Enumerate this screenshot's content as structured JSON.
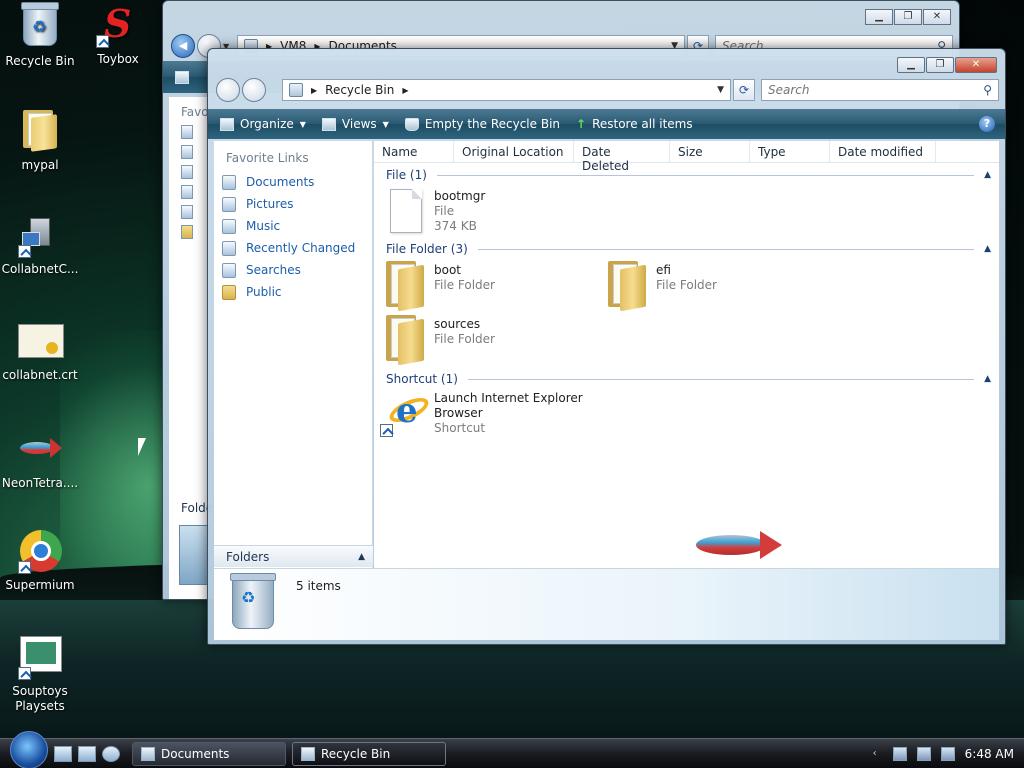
{
  "desktop": {
    "icons": [
      {
        "label": "Recycle Bin"
      },
      {
        "label": "Toybox"
      },
      {
        "label": "mypal"
      },
      {
        "label": "CollabnetC..."
      },
      {
        "label": "collabnet.crt"
      },
      {
        "label": "NeonTetra...."
      },
      {
        "label": "Supermium"
      },
      {
        "label": "Souptoys Playsets"
      }
    ]
  },
  "back_window": {
    "address": {
      "root": "VM8",
      "current": "Documents"
    },
    "search_placeholder": "Search",
    "favorites_heading": "Favori",
    "folders_label": "Folde"
  },
  "front_window": {
    "address": {
      "current": "Recycle Bin"
    },
    "search_placeholder": "Search",
    "toolbar": {
      "organize": "Organize",
      "views": "Views",
      "empty": "Empty the Recycle Bin",
      "restore": "Restore all items"
    },
    "nav": {
      "heading": "Favorite Links",
      "links": [
        "Documents",
        "Pictures",
        "Music",
        "Recently Changed",
        "Searches",
        "Public"
      ],
      "folders_label": "Folders"
    },
    "columns": [
      "Name",
      "Original Location",
      "Date Deleted",
      "Size",
      "Type",
      "Date modified"
    ],
    "groups": [
      {
        "title": "File (1)",
        "items": [
          {
            "name": "bootmgr",
            "type": "File",
            "size": "374 KB"
          }
        ]
      },
      {
        "title": "File Folder (3)",
        "items": [
          {
            "name": "boot",
            "type": "File Folder"
          },
          {
            "name": "efi",
            "type": "File Folder"
          },
          {
            "name": "sources",
            "type": "File Folder"
          }
        ]
      },
      {
        "title": "Shortcut (1)",
        "items": [
          {
            "name": "Launch Internet Explorer",
            "name2": "Browser",
            "type": "Shortcut"
          }
        ]
      }
    ],
    "status": {
      "count": "5 items"
    }
  },
  "taskbar": {
    "buttons": [
      "Documents",
      "Recycle Bin"
    ],
    "clock": "6:48 AM"
  }
}
